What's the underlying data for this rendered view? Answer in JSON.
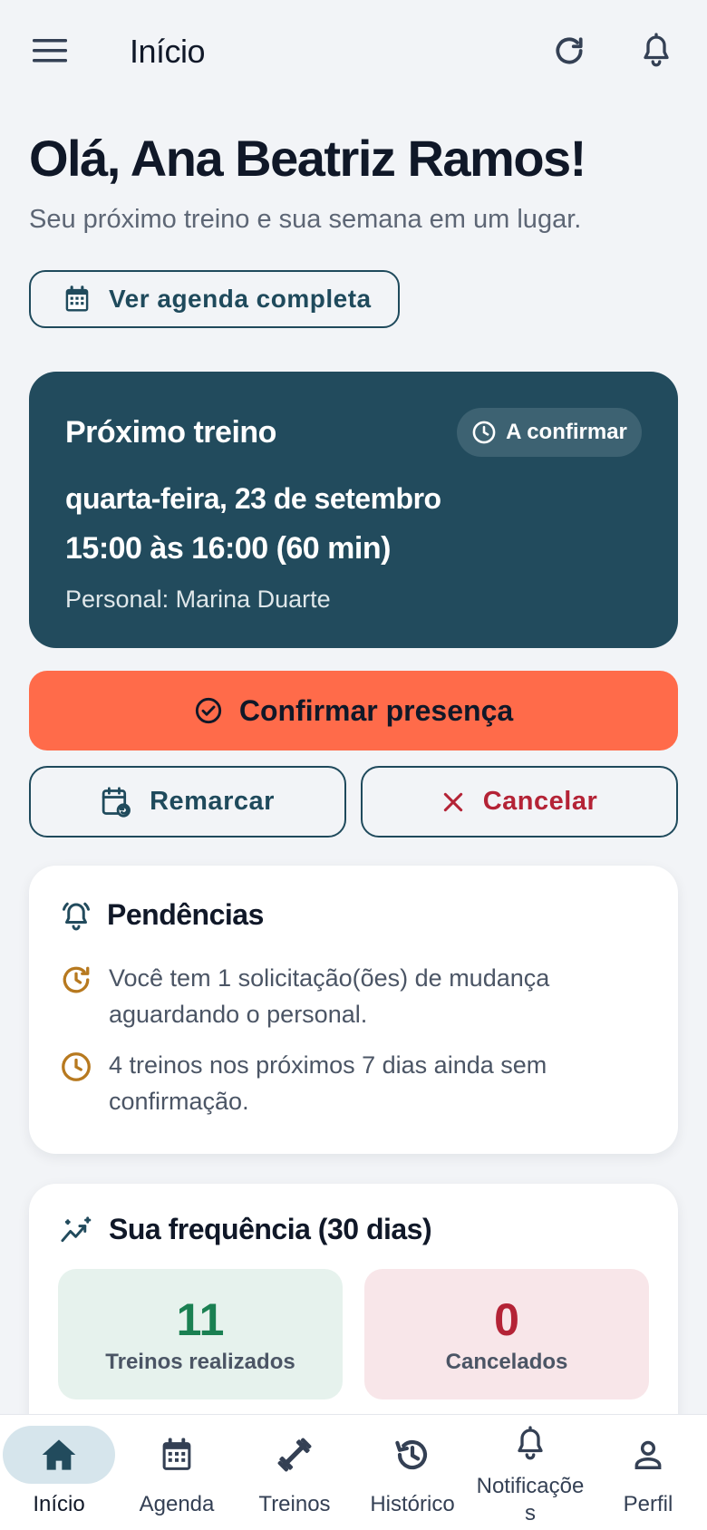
{
  "header": {
    "title": "Início"
  },
  "greeting": {
    "title": "Olá, Ana Beatriz Ramos!",
    "subtitle": "Seu próximo treino e sua semana em um lugar."
  },
  "agenda_button": {
    "label": "Ver agenda completa"
  },
  "next_workout": {
    "title": "Próximo treino",
    "status": "A confirmar",
    "date": "quarta-feira, 23 de setembro",
    "time": "15:00 às 16:00 (60 min)",
    "trainer": "Personal: Marina Duarte"
  },
  "actions": {
    "confirm": "Confirmar presença",
    "reschedule": "Remarcar",
    "cancel": "Cancelar"
  },
  "pending": {
    "title": "Pendências",
    "items": [
      "Você tem 1 solicitação(ões) de mudança aguardando o personal.",
      "4 treinos nos próximos 7 dias ainda sem confirmação."
    ]
  },
  "frequency": {
    "title": "Sua frequência (30 dias)",
    "done_value": "11",
    "done_label": "Treinos realizados",
    "cancel_value": "0",
    "cancel_label": "Cancelados"
  },
  "nav": {
    "items": [
      {
        "label": "Início"
      },
      {
        "label": "Agenda"
      },
      {
        "label": "Treinos"
      },
      {
        "label": "Histórico"
      },
      {
        "label": "Notificações"
      },
      {
        "label": "Perfil"
      }
    ]
  },
  "colors": {
    "primary": "#224b5d",
    "accent": "#ff6b4a",
    "danger": "#b42336",
    "success": "#1a8052",
    "warning": "#b7791f"
  }
}
